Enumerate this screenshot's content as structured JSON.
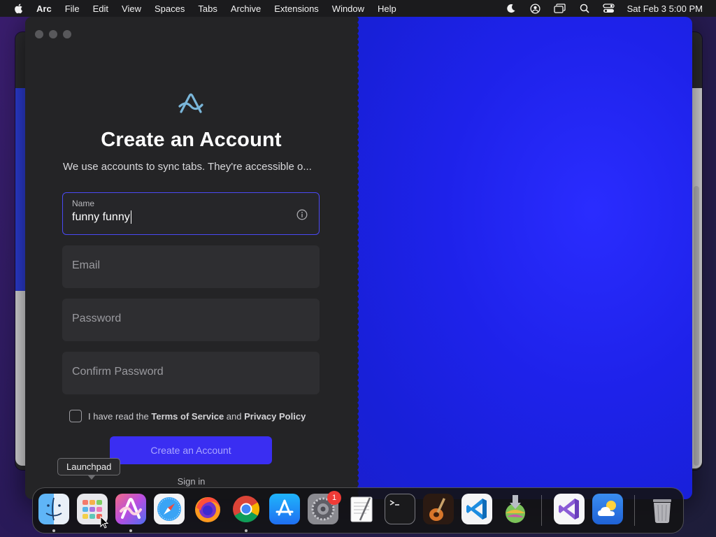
{
  "menubar": {
    "app_name": "Arc",
    "items": [
      "File",
      "Edit",
      "View",
      "Spaces",
      "Tabs",
      "Archive",
      "Extensions",
      "Window",
      "Help"
    ],
    "clock": "Sat Feb 3  5:00 PM",
    "status_icons": [
      "moon-icon",
      "user-circle-icon",
      "screens-icon",
      "search-icon",
      "control-center-icon"
    ]
  },
  "signup": {
    "title": "Create an Account",
    "subtitle": "We use accounts to sync tabs. They're accessible o...",
    "name_label": "Name",
    "name_value": "funny funny",
    "email_placeholder": "Email",
    "password_placeholder": "Password",
    "confirm_placeholder": "Confirm Password",
    "terms_prefix": "I have read the",
    "terms_of_service": "Terms of Service",
    "terms_and": "and",
    "privacy_policy": "Privacy Policy",
    "terms_checked": false,
    "create_button": "Create an Account",
    "sign_in": "Sign in"
  },
  "tooltip": {
    "text": "Launchpad"
  },
  "dock": {
    "apps": [
      {
        "name": "Finder",
        "icon": "finder-icon",
        "running": true
      },
      {
        "name": "Launchpad",
        "icon": "launchpad-icon",
        "running": false
      },
      {
        "name": "Arc",
        "icon": "arc-icon",
        "running": true
      },
      {
        "name": "Safari",
        "icon": "safari-icon",
        "running": false
      },
      {
        "name": "Firefox",
        "icon": "firefox-icon",
        "running": false
      },
      {
        "name": "Chrome",
        "icon": "chrome-icon",
        "running": true
      },
      {
        "name": "App Store",
        "icon": "app-store-icon",
        "running": false
      },
      {
        "name": "System Settings",
        "icon": "settings-icon",
        "running": false,
        "badge": "1"
      },
      {
        "name": "TextEdit",
        "icon": "textedit-icon",
        "running": false
      },
      {
        "name": "Terminal",
        "icon": "terminal-icon",
        "running": false
      },
      {
        "name": "GarageBand",
        "icon": "garageband-icon",
        "running": false
      },
      {
        "name": "Visual Studio Code",
        "icon": "vscode-icon",
        "running": false
      },
      {
        "name": "macOS Installer",
        "icon": "installer-icon",
        "running": false
      },
      {
        "name": "Visual Studio",
        "icon": "visual-studio-icon",
        "running": false
      },
      {
        "name": "Weather",
        "icon": "weather-icon",
        "running": false
      },
      {
        "name": "Trash",
        "icon": "trash-icon",
        "running": false
      }
    ]
  },
  "colors": {
    "accent": "#3a2ef2",
    "focus_border": "#4a49f5",
    "panel_bg": "#242426",
    "right_pane_blue": "#1e22ea"
  }
}
